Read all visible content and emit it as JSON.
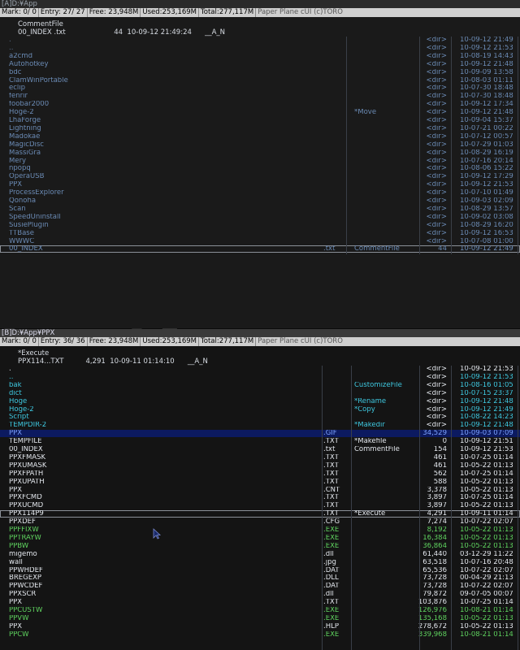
{
  "paneA": {
    "title": "[A]D:¥App",
    "status": {
      "mark": "Mark:  0/      0",
      "entry": "Entry: 27/  27",
      "free": "Free: 23,948M",
      "used": "Used:253,169M",
      "total": "Total:277,117M",
      "brand": "Paper Plane cUI (c)TORO"
    },
    "info_comment": "CommentFile",
    "info_line": "00_INDEX .txt                      44  10-09-12 21:49:24      __A_N",
    "rows": [
      {
        "name": ".",
        "ext": "",
        "cmt": "",
        "size": "<dir>",
        "date": "10-09-12 21:49",
        "cls": "dim"
      },
      {
        "name": "..",
        "ext": "",
        "cmt": "",
        "size": "<dir>",
        "date": "10-09-12 21:53",
        "cls": "dim"
      },
      {
        "name": "a2cmd",
        "ext": "",
        "cmt": "",
        "size": "<dir>",
        "date": "10-08-19 14:43",
        "cls": "dir"
      },
      {
        "name": "Autohotkey",
        "ext": "",
        "cmt": "",
        "size": "<dir>",
        "date": "10-09-12 21:48",
        "cls": "dir"
      },
      {
        "name": "bdc",
        "ext": "",
        "cmt": "",
        "size": "<dir>",
        "date": "10-09-09 13:58",
        "cls": "dir"
      },
      {
        "name": "ClamWinPortable",
        "ext": "",
        "cmt": "",
        "size": "<dir>",
        "date": "10-08-03 01:11",
        "cls": "dir"
      },
      {
        "name": "eclip",
        "ext": "",
        "cmt": "",
        "size": "<dir>",
        "date": "10-07-30 18:48",
        "cls": "dir"
      },
      {
        "name": "fenrir",
        "ext": "",
        "cmt": "",
        "size": "<dir>",
        "date": "10-07-30 18:48",
        "cls": "dir"
      },
      {
        "name": "foobar2000",
        "ext": "",
        "cmt": "",
        "size": "<dir>",
        "date": "10-09-12 17:34",
        "cls": "dir"
      },
      {
        "name": "Hoge-2",
        "ext": "",
        "cmt": "*Move",
        "size": "<dir>",
        "date": "10-09-12 21:48",
        "cls": "dir"
      },
      {
        "name": "LhaForge",
        "ext": "",
        "cmt": "",
        "size": "<dir>",
        "date": "10-09-04 15:37",
        "cls": "dir"
      },
      {
        "name": "Lightning",
        "ext": "",
        "cmt": "",
        "size": "<dir>",
        "date": "10-07-21 00:22",
        "cls": "dir"
      },
      {
        "name": "Madokae",
        "ext": "",
        "cmt": "",
        "size": "<dir>",
        "date": "10-07-12 00:57",
        "cls": "dir"
      },
      {
        "name": "MagicDisc",
        "ext": "",
        "cmt": "",
        "size": "<dir>",
        "date": "10-07-29 01:03",
        "cls": "dir"
      },
      {
        "name": "MassiGra",
        "ext": "",
        "cmt": "",
        "size": "<dir>",
        "date": "10-08-29 16:19",
        "cls": "dir"
      },
      {
        "name": "Mery",
        "ext": "",
        "cmt": "",
        "size": "<dir>",
        "date": "10-07-16 20:14",
        "cls": "dir"
      },
      {
        "name": "npopq",
        "ext": "",
        "cmt": "",
        "size": "<dir>",
        "date": "10-08-06 15:22",
        "cls": "dir"
      },
      {
        "name": "OperaUSB",
        "ext": "",
        "cmt": "",
        "size": "<dir>",
        "date": "10-09-12 17:29",
        "cls": "dir"
      },
      {
        "name": "PPX",
        "ext": "",
        "cmt": "",
        "size": "<dir>",
        "date": "10-09-12 21:53",
        "cls": "dir"
      },
      {
        "name": "ProcessExplorer",
        "ext": "",
        "cmt": "",
        "size": "<dir>",
        "date": "10-07-10 01:49",
        "cls": "dir"
      },
      {
        "name": "Qonoha",
        "ext": "",
        "cmt": "",
        "size": "<dir>",
        "date": "10-09-03 02:09",
        "cls": "dir"
      },
      {
        "name": "Scan",
        "ext": "",
        "cmt": "",
        "size": "<dir>",
        "date": "10-08-29 13:57",
        "cls": "dir"
      },
      {
        "name": "SpeedUninstall",
        "ext": "",
        "cmt": "",
        "size": "<dir>",
        "date": "10-09-02 03:08",
        "cls": "dir"
      },
      {
        "name": "SusiePlugin",
        "ext": "",
        "cmt": "",
        "size": "<dir>",
        "date": "10-08-29 16:20",
        "cls": "dir"
      },
      {
        "name": "TTBase",
        "ext": "",
        "cmt": "",
        "size": "<dir>",
        "date": "10-09-12 16:53",
        "cls": "dir"
      },
      {
        "name": "WWWC",
        "ext": "",
        "cmt": "",
        "size": "<dir>",
        "date": "10-07-08 01:00",
        "cls": "dir"
      },
      {
        "name": "00_INDEX",
        "ext": ".txt",
        "cmt": "CommentFile",
        "size": "44",
        "date": "10-09-12 21:49",
        "cls": "dir sel"
      }
    ]
  },
  "paneB": {
    "title": "[B]D:¥App¥PPX",
    "status": {
      "mark": "Mark:  0/      0",
      "entry": "Entry: 36/  36",
      "free": "Free: 23,948M",
      "used": "Used:253,169M",
      "total": "Total:277,117M",
      "brand": "Paper Plane cUI (c)TORO"
    },
    "info_comment": "*Execute",
    "info_line": "PPX114...TXT          4,291  10-09-11 01:14:10      __A_N",
    "rows": [
      {
        "name": ".",
        "ext": "",
        "cmt": "",
        "size": "<dir>",
        "date": "10-09-12 21:53",
        "cls": "white"
      },
      {
        "name": "..",
        "ext": "",
        "cmt": "",
        "size": "<dir>",
        "date": "10-09-12 21:53",
        "cls": "cyan"
      },
      {
        "name": "bak",
        "ext": "",
        "cmt": "CustomizeFile",
        "size": "<dir>",
        "date": "10-08-16 01:05",
        "cls": "cyan"
      },
      {
        "name": "dict",
        "ext": "",
        "cmt": "",
        "size": "<dir>",
        "date": "10-07-15 23:37",
        "cls": "cyan"
      },
      {
        "name": "Hoge",
        "ext": "",
        "cmt": "*Rename",
        "size": "<dir>",
        "date": "10-09-12 21:48",
        "cls": "cyan"
      },
      {
        "name": "Hoge-2",
        "ext": "",
        "cmt": "*Copy",
        "size": "<dir>",
        "date": "10-09-12 21:49",
        "cls": "cyan"
      },
      {
        "name": "Script",
        "ext": "",
        "cmt": "",
        "size": "<dir>",
        "date": "10-08-22 14:23",
        "cls": "cyan"
      },
      {
        "name": "TEMPDIR-2",
        "ext": "",
        "cmt": "*Makedir",
        "size": "<dir>",
        "date": "10-09-12 21:48",
        "cls": "cyan"
      },
      {
        "name": "PPX",
        "ext": ".GIF",
        "cmt": "",
        "size": "34,529",
        "date": "10-09-03 07:09",
        "cls": "blue hl"
      },
      {
        "name": "TEMPFILE",
        "ext": ".TXT",
        "cmt": "*Makefile",
        "size": "0",
        "date": "10-09-12 21:51",
        "cls": "white"
      },
      {
        "name": "00_INDEX",
        "ext": ".txt",
        "cmt": "CommentFile",
        "size": "154",
        "date": "10-09-12 21:53",
        "cls": "white"
      },
      {
        "name": "PPXFMASK",
        "ext": ".TXT",
        "cmt": "",
        "size": "461",
        "date": "10-07-25 01:14",
        "cls": "white"
      },
      {
        "name": "PPXUMASK",
        "ext": ".TXT",
        "cmt": "",
        "size": "461",
        "date": "10-05-22 01:13",
        "cls": "white"
      },
      {
        "name": "PPXFPATH",
        "ext": ".TXT",
        "cmt": "",
        "size": "562",
        "date": "10-07-25 01:14",
        "cls": "white"
      },
      {
        "name": "PPXUPATH",
        "ext": ".TXT",
        "cmt": "",
        "size": "588",
        "date": "10-05-22 01:13",
        "cls": "white"
      },
      {
        "name": "PPX",
        "ext": ".CNT",
        "cmt": "",
        "size": "3,378",
        "date": "10-05-22 01:13",
        "cls": "white"
      },
      {
        "name": "PPXFCMD",
        "ext": ".TXT",
        "cmt": "",
        "size": "3,897",
        "date": "10-07-25 01:14",
        "cls": "white"
      },
      {
        "name": "PPXUCMD",
        "ext": ".TXT",
        "cmt": "",
        "size": "3,897",
        "date": "10-05-22 01:13",
        "cls": "white"
      },
      {
        "name": "PPX114P9",
        "ext": ".TXT",
        "cmt": "*Execute",
        "size": "4,291",
        "date": "10-09-11 01:14",
        "cls": "white sel"
      },
      {
        "name": "PPXDEF",
        "ext": ".CFG",
        "cmt": "",
        "size": "7,274",
        "date": "10-07-22 02:07",
        "cls": "white"
      },
      {
        "name": "PPFFIXW",
        "ext": ".EXE",
        "cmt": "",
        "size": "8,192",
        "date": "10-05-22 01:13",
        "cls": "green"
      },
      {
        "name": "PPTRAYW",
        "ext": ".EXE",
        "cmt": "",
        "size": "16,384",
        "date": "10-05-22 01:13",
        "cls": "green"
      },
      {
        "name": "PPBW",
        "ext": ".EXE",
        "cmt": "",
        "size": "36,864",
        "date": "10-05-22 01:13",
        "cls": "green"
      },
      {
        "name": "migemo",
        "ext": ".dll",
        "cmt": "",
        "size": "61,440",
        "date": "03-12-29 11:22",
        "cls": "white"
      },
      {
        "name": "wall",
        "ext": ".jpg",
        "cmt": "",
        "size": "63,518",
        "date": "10-07-16 20:48",
        "cls": "white"
      },
      {
        "name": "PPWHDEF",
        "ext": ".DAT",
        "cmt": "",
        "size": "65,536",
        "date": "10-07-22 02:07",
        "cls": "white"
      },
      {
        "name": "BREGEXP",
        "ext": ".DLL",
        "cmt": "",
        "size": "73,728",
        "date": "00-04-29 21:13",
        "cls": "white"
      },
      {
        "name": "PPWCDEF",
        "ext": ".DAT",
        "cmt": "",
        "size": "73,728",
        "date": "10-07-22 02:07",
        "cls": "white"
      },
      {
        "name": "PPXSCR",
        "ext": ".dll",
        "cmt": "",
        "size": "79,872",
        "date": "09-07-05 00:07",
        "cls": "white"
      },
      {
        "name": "PPX",
        "ext": ".TXT",
        "cmt": "",
        "size": "103,876",
        "date": "10-07-25 01:14",
        "cls": "white"
      },
      {
        "name": "PPCUSTW",
        "ext": ".EXE",
        "cmt": "",
        "size": "126,976",
        "date": "10-08-21 01:14",
        "cls": "green"
      },
      {
        "name": "PPVW",
        "ext": ".EXE",
        "cmt": "",
        "size": "135,168",
        "date": "10-05-22 01:13",
        "cls": "green"
      },
      {
        "name": "PPX",
        "ext": ".HLP",
        "cmt": "",
        "size": "278,672",
        "date": "10-05-22 01:13",
        "cls": "white"
      },
      {
        "name": "PPCW",
        "ext": ".EXE",
        "cmt": "",
        "size": "339,968",
        "date": "10-08-21 01:14",
        "cls": "green"
      }
    ]
  }
}
